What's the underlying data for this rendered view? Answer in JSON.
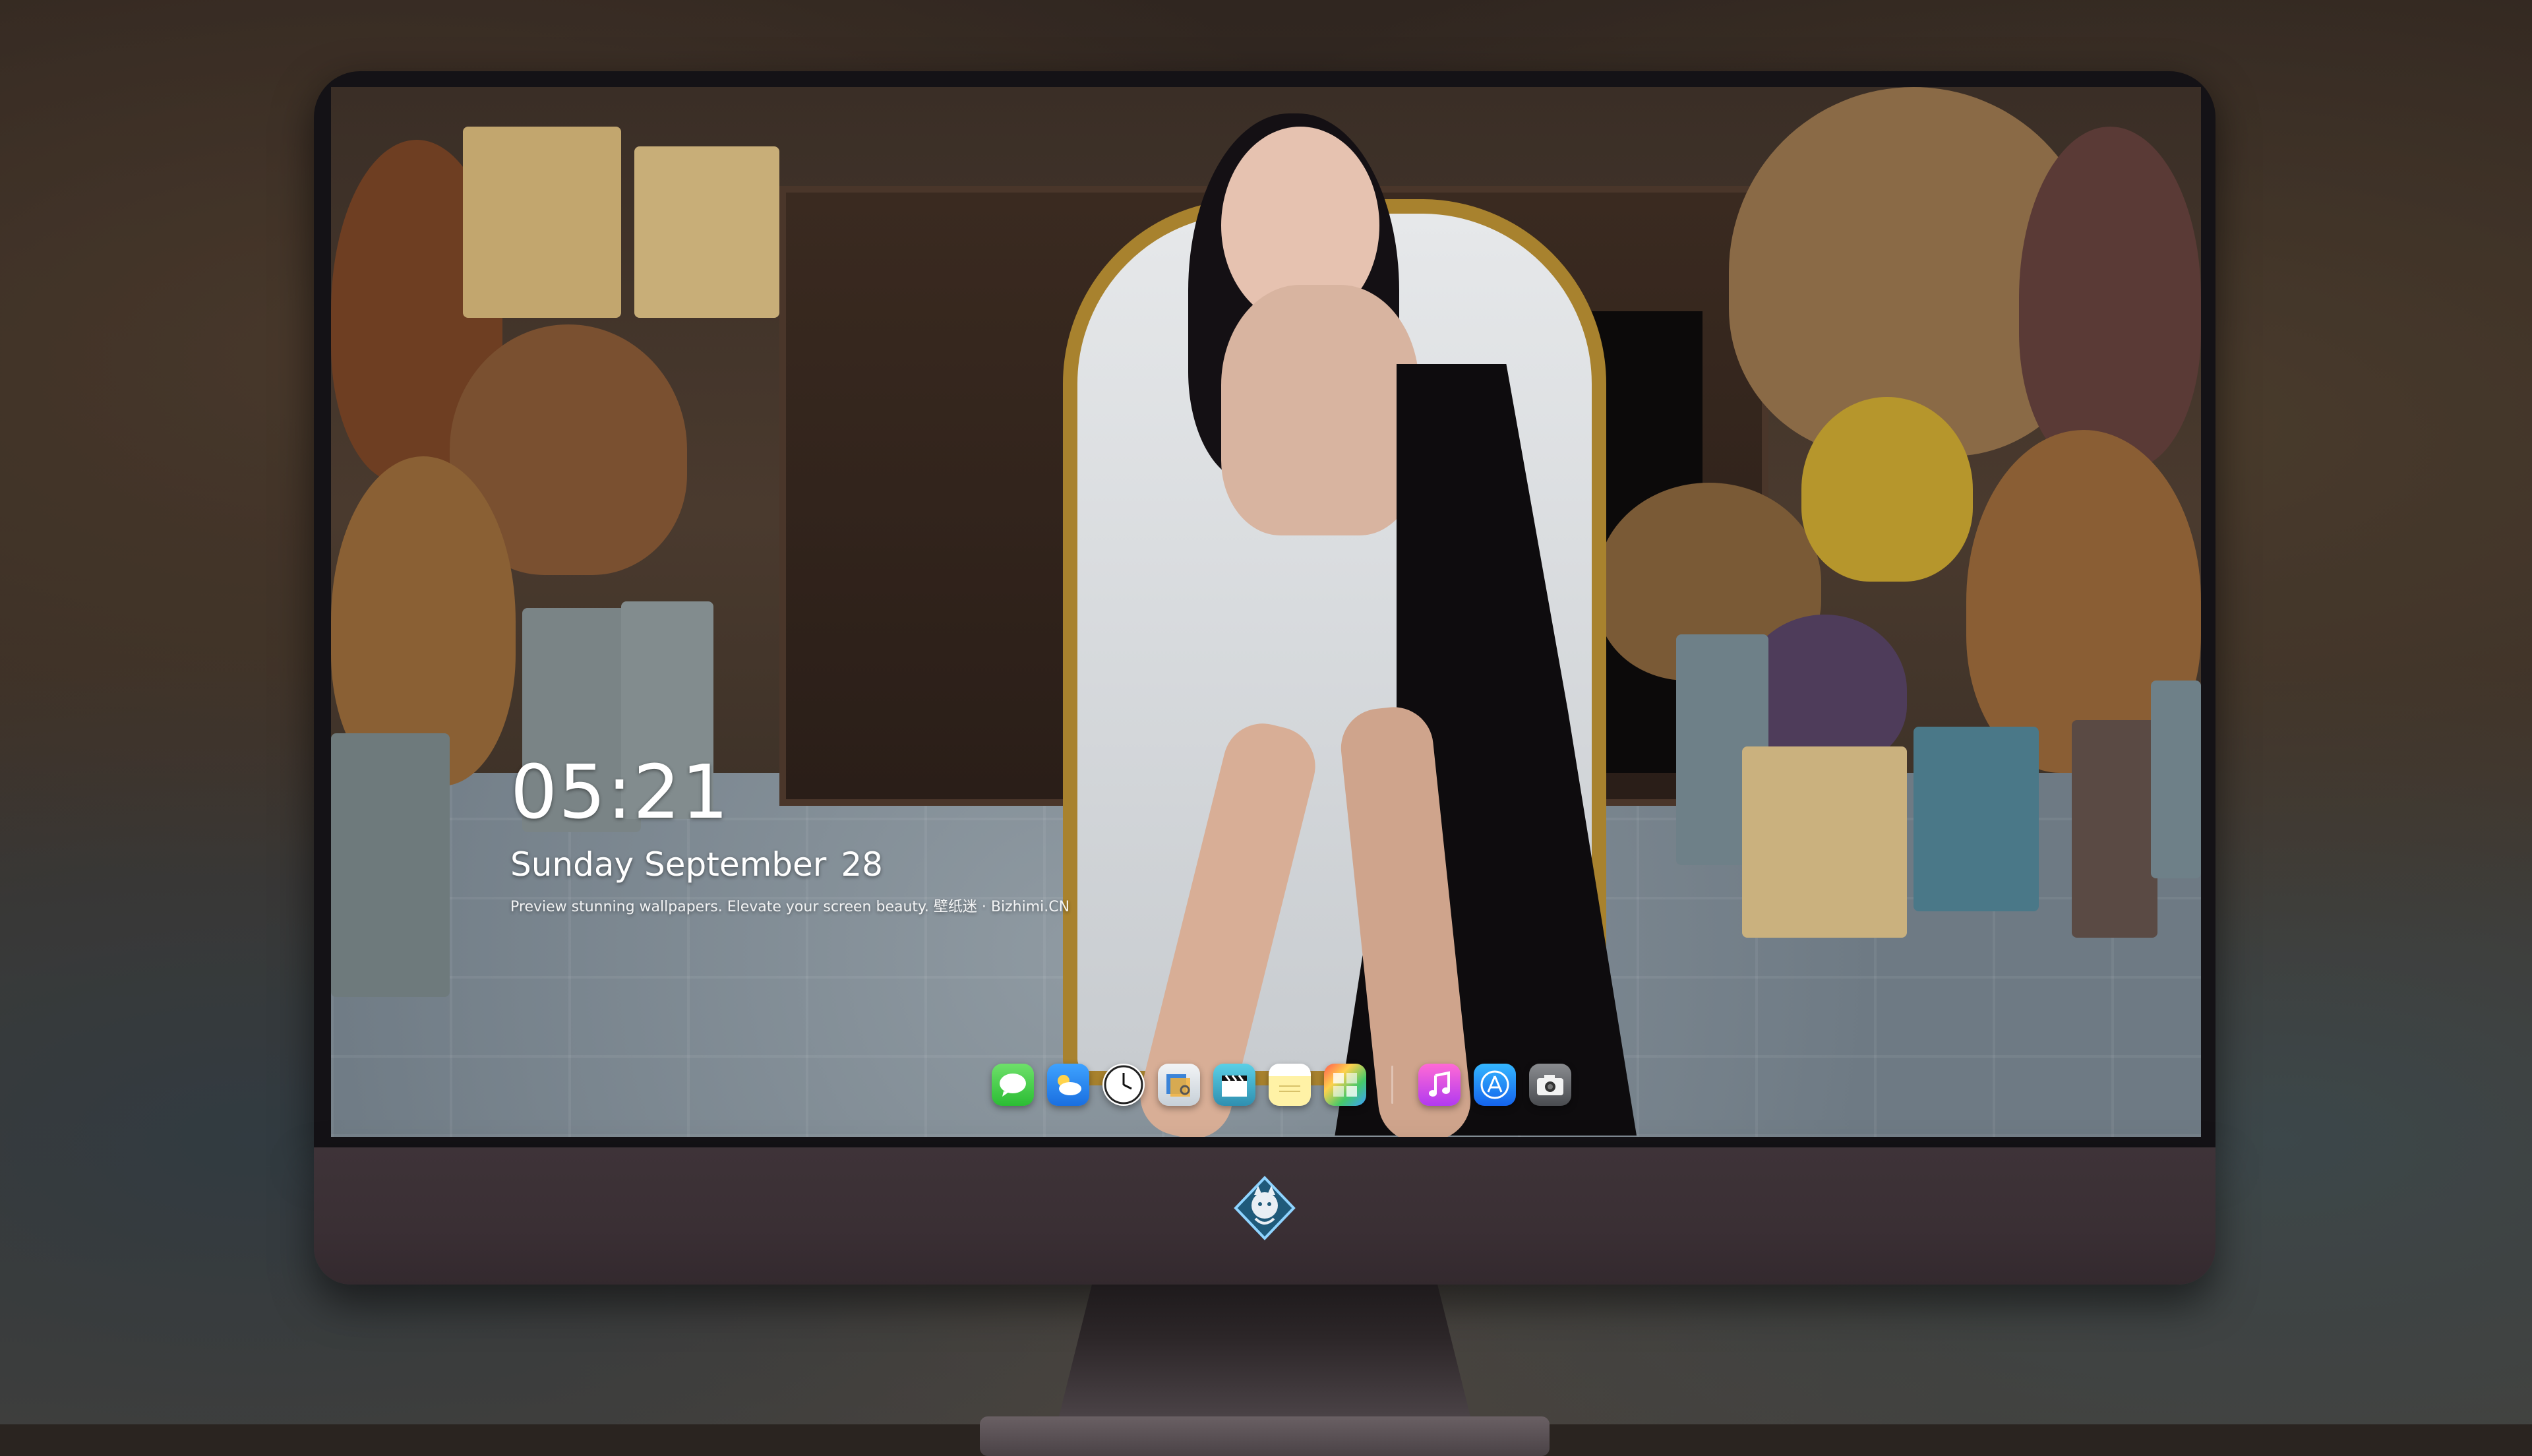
{
  "lockscreen": {
    "time": "05:21",
    "weekday_month": "Sunday September",
    "day": "28",
    "tagline": "Preview stunning wallpapers. Elevate your screen beauty. 壁纸迷 · Bizhimi.CN"
  },
  "dock": {
    "apps": [
      {
        "icon": "messages-icon",
        "color": "#2bbd34"
      },
      {
        "icon": "weather-icon",
        "color": "#1a6fe0"
      },
      {
        "icon": "clock-icon",
        "color": "#ffffff"
      },
      {
        "icon": "preview-icon",
        "color": "#c7d0d8"
      },
      {
        "icon": "video-clapper-icon",
        "color": "#2f8fb0"
      },
      {
        "icon": "notes-icon",
        "color": "#fff2a6"
      },
      {
        "icon": "photo-booth-icon",
        "color": "#ffd14d"
      },
      {
        "icon": "music-icon",
        "color": "#b23af0"
      },
      {
        "icon": "app-store-icon",
        "color": "#1463ec"
      },
      {
        "icon": "camera-icon",
        "color": "#4a4c50"
      }
    ]
  },
  "monitor": {
    "logo": "bizhimi-logo-icon"
  }
}
